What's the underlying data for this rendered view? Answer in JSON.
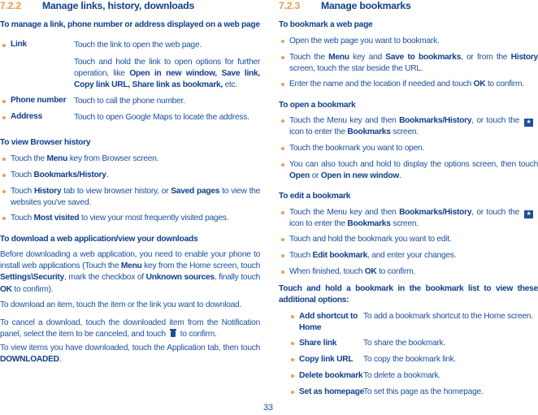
{
  "left": {
    "section_number": "7.2.2",
    "section_title": "Manage links, history, downloads",
    "manage_heading": "To manage a link, phone number or address displayed on a web page",
    "link_items": [
      {
        "term": "Link",
        "desc": "Touch the link to open the web page."
      },
      {
        "term": "",
        "desc_parts": [
          "Touch and hold the link to open options for further operation, like ",
          "Open in new window, Save link, Copy link URL, Share link as bookmark,",
          " etc."
        ]
      },
      {
        "term": "Phone number",
        "desc": "Touch to call the phone number."
      },
      {
        "term": "Address",
        "desc": "Touch to open Google Maps to locate the address."
      }
    ],
    "history_heading": "To view Browser history",
    "history_bullets": [
      {
        "a": "Touch the ",
        "b": "Menu",
        "c": " key from Browser screen."
      },
      {
        "a": "Touch ",
        "b": "Bookmarks/History",
        "c": "."
      },
      {
        "a": "Touch ",
        "b": "History",
        "c": " tab to view browser history, or ",
        "d": "Saved pages",
        "e": " to view the websites you've saved."
      },
      {
        "a": "Touch ",
        "b": "Most visited",
        "c": " to view your most frequently visited pages."
      }
    ],
    "download_heading": "To download a web application/view your downloads",
    "download_p1": {
      "a": "Before downloading a web application, you need to enable your phone to install web applications (Touch the ",
      "b": "Menu",
      "c": " key from the Home screen, touch ",
      "d": "Settings\\Security",
      "e": ", mark the checkbox of ",
      "f": "Unknown sources",
      "g": ", finally touch ",
      "h": "OK",
      "i": " to confirm)."
    },
    "download_p2": "To download an item, touch the item or the link you want to download.",
    "download_p3": {
      "a": "To cancel a download, touch the downloaded item from the Notification panel, select the item to be canceled, and touch",
      "icon": "trash-icon",
      "b": "to confirm."
    },
    "download_p4": {
      "a": "To view items you have downloaded, touch the Application tab, then touch ",
      "b": "DOWNLOADED",
      "c": "."
    }
  },
  "right": {
    "section_number": "7.2.3",
    "section_title": "Manage bookmarks",
    "bookmark_heading": "To bookmark a web page",
    "bookmark_bullets": [
      {
        "a": "Open the web page you want to bookmark."
      },
      {
        "a": "Touch the ",
        "b": "Menu",
        "c": " key and ",
        "d": "Save to bookmarks",
        "e": ", or from the ",
        "f": "History",
        "g": " screen, touch the star beside the URL."
      },
      {
        "a": "Enter the name and the location if needed and touch ",
        "b": "OK",
        "c": " to confirm."
      }
    ],
    "open_heading": "To open a bookmark",
    "open_bullets": [
      {
        "a": "Touch the Menu key and then ",
        "b": "Bookmarks/History",
        "c": ", or touch the",
        "icon": "bookmark-icon",
        "d": "icon to enter the ",
        "e": "Bookmarks",
        "f": " screen."
      },
      {
        "a": "Touch the bookmark you want to open."
      },
      {
        "a": "You can also touch and hold to display the options screen, then touch ",
        "b": "Open",
        "c": " or ",
        "d": "Open in new window",
        "e": "."
      }
    ],
    "edit_heading": "To edit a bookmark",
    "edit_bullets": [
      {
        "a": "Touch the Menu key and then ",
        "b": "Bookmarks/History",
        "c": ", or touch the",
        "icon": "bookmark-icon",
        "d": "icon to enter the ",
        "e": "Bookmarks",
        "f": " screen."
      },
      {
        "a": "Touch and hold the bookmark you want to edit."
      },
      {
        "a": "Touch ",
        "b": "Edit bookmark",
        "c": ", and enter your changes."
      },
      {
        "a": "When finished, touch ",
        "b": "OK",
        "c": " to confirm."
      }
    ],
    "options_heading": "Touch and hold a bookmark in the bookmark list to view these additional options:",
    "options": [
      {
        "term_line1": "Add shortcut to",
        "term_line2": "Home",
        "desc": "To add a bookmark shortcut to the Home screen."
      },
      {
        "term_line1": "Share link",
        "desc": "To share the bookmark."
      },
      {
        "term_line1": "Copy link URL",
        "desc": "To copy the bookmark link."
      },
      {
        "term_line1": "Delete bookmark",
        "desc": "To delete a bookmark."
      },
      {
        "term_line1": "Set as homepage",
        "desc": "To set this page as the homepage."
      }
    ]
  },
  "page_number": "33",
  "colors": {
    "heading_blue": "#0f3f8c",
    "text_blue": "#1a4f9c",
    "accent_orange": "#f29a4a"
  }
}
